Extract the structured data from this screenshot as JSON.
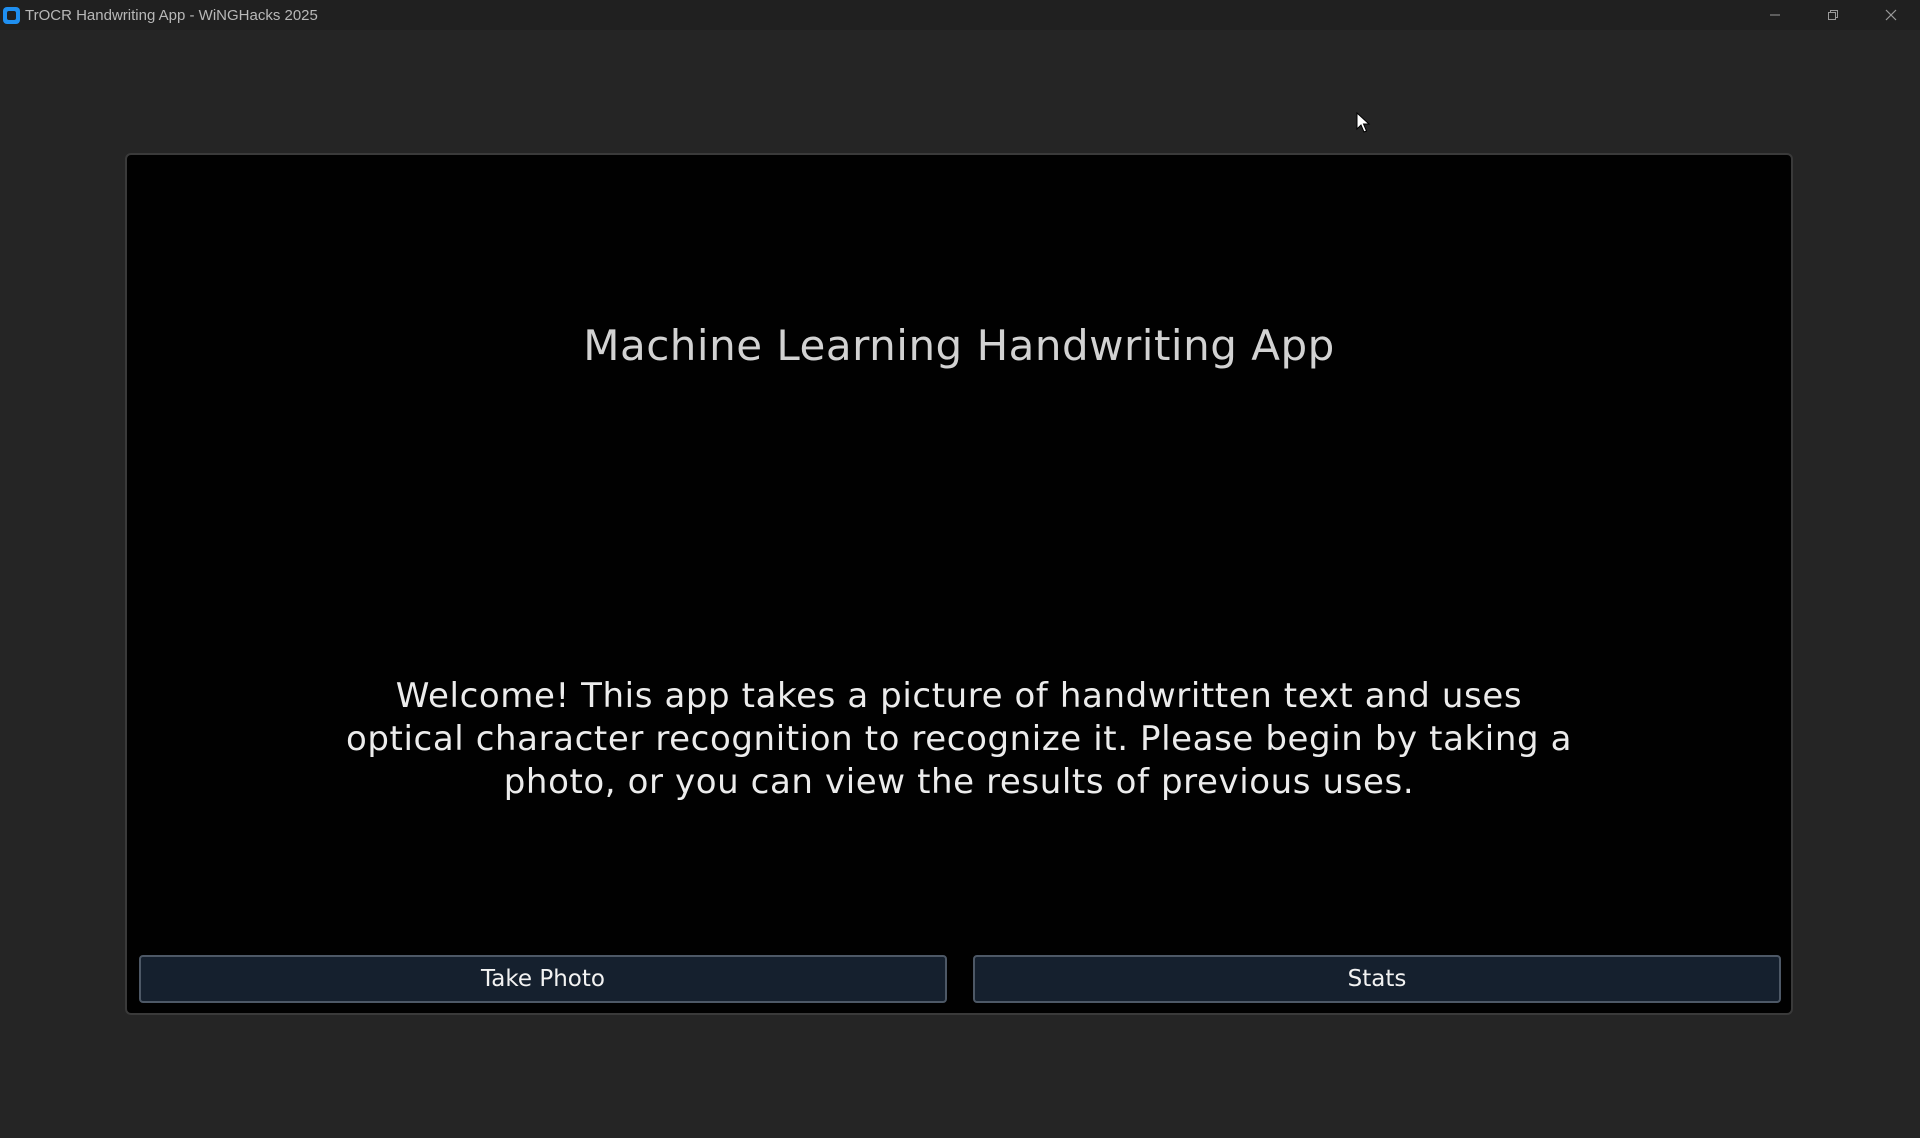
{
  "window": {
    "title": "TrOCR Handwriting App - WiNGHacks 2025",
    "icon": "app-icon",
    "controls": [
      "minimize-icon",
      "restore-icon",
      "close-icon"
    ]
  },
  "main": {
    "heading": "Machine Learning Handwriting App",
    "welcome": "Welcome! This app takes a picture of handwritten text and uses optical character recognition to recognize it. Please begin by taking a photo, or you can view the results of previous uses.",
    "buttons": {
      "take_photo": "Take Photo",
      "stats": "Stats"
    }
  },
  "colors": {
    "background": "#252525",
    "panel": "#010101",
    "button_fill": "#15202e",
    "button_border": "#4d5866",
    "accent_icon": "#1f8ff0"
  }
}
